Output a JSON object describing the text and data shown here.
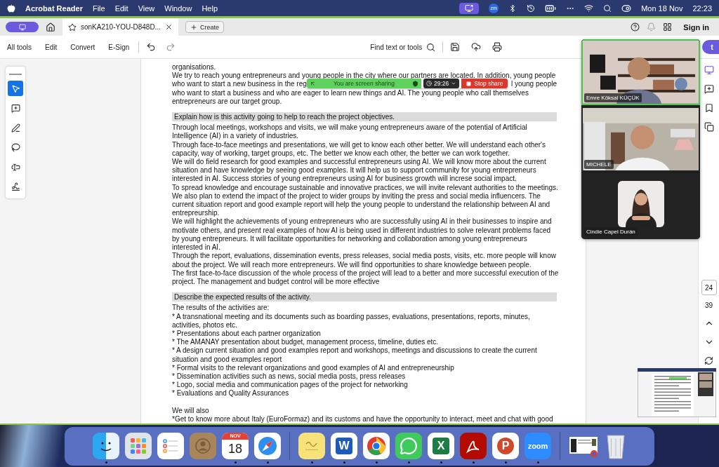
{
  "menu_bar": {
    "app_name": "Acrobat Reader",
    "menus": [
      "File",
      "Edit",
      "View",
      "Window",
      "Help"
    ],
    "zoom_badge": "zm",
    "date": "Mon 18 Nov",
    "time": "22:23"
  },
  "tab_bar": {
    "tabs": [
      {
        "label": "sonKA210-YOU-D848D...",
        "selected": true
      }
    ],
    "create_button": "Create",
    "sign_in": "Sign in"
  },
  "toolbar": {
    "items": [
      "All tools",
      "Edit",
      "Convert",
      "E-Sign"
    ],
    "search": "Find text or tools",
    "action_button": "t"
  },
  "tools": [
    {
      "kind": "select",
      "selected": true
    },
    {
      "kind": "comment",
      "selected": false
    },
    {
      "kind": "draw",
      "selected": false
    },
    {
      "kind": "lasso",
      "selected": false
    },
    {
      "kind": "text",
      "selected": false
    },
    {
      "kind": "sign",
      "selected": false
    }
  ],
  "document": {
    "blocks": [
      {
        "kind": "text",
        "text": "organisations."
      },
      {
        "kind": "text",
        "text": "We try to reach young entrepreneurs and young people in the city where our partners are located. In addition, young people"
      },
      {
        "kind": "split",
        "left": "who want to start a new business in the reg",
        "right": "l young people"
      },
      {
        "kind": "text",
        "text": "who want to start a business and who are eager to learn new things and AI. The young people who call themselves entrepreneurs are our target group."
      },
      {
        "kind": "heading",
        "text": "Explain how is this activity going to help to reach the project objectives."
      },
      {
        "kind": "text",
        "text": "Through local meetings, workshops and visits, we will make young entrepreneurs aware of the potential of Artificial Intelligence (AI) in a variety of industries."
      },
      {
        "kind": "text",
        "text": "Through face-to-face meetings and presentations, we will get to know each other better. We will understand each other's capacity, way of working, target groups, etc. The better we know each other, the better we can work together."
      },
      {
        "kind": "text",
        "text": "We will do field research for good examples and successful entrepreneurs using AI. We will know more about the current situation and have knowledge by seeing good examples. It will help us to support community for young entrepreneurs interested in AI. Success stories of young entrepreneurs using AI for business growth will increse social impact."
      },
      {
        "kind": "text",
        "text": "To spread knowledge and encourage sustainable and innovative practices, we will invite relevant authorities to the meetings. We also plan to extend the impact of the project to wider groups by inviting the press and social media influencers. The current situation report and good example report will help the young people to understand the relationship between AI and entrepreurship."
      },
      {
        "kind": "text",
        "text": "We will highlight the achievements of young entrepreneurs who are successfully using AI in their businesses to inspire and motivate others, and present real examples of how AI is being used in different industries to solve relevant problems faced by young entrepreneurs. It will facilitate opportunities for networking and collaboration among young entrepreneurs interested in AI."
      },
      {
        "kind": "text",
        "text": "Through the report, evaluations, dissemination events, press releases, social media posts, visits, etc. more people will know about the project. We will reach more entrepreneurs. We will find opportunities to share knowledge between people."
      },
      {
        "kind": "text",
        "text": "The first face-to-face discussion of the whole process of the project will lead to a better and more successful execution of the project. The management and budget control will be more effective"
      },
      {
        "kind": "heading",
        "text": "Describe the expected results of the activity."
      },
      {
        "kind": "text",
        "text": "The results of the activities are:"
      },
      {
        "kind": "text",
        "text": "* A transnational meeting and its documents such as boarding passes, evaluations, presentations, reports, minutes, activities, photos etc."
      },
      {
        "kind": "text",
        "text": "* Presentations about each partner organization"
      },
      {
        "kind": "text",
        "text": "* The AMANAY presentation about budget, management process, timeline, duties etc."
      },
      {
        "kind": "text",
        "text": "* A design current situation and good examples report and workshops, meetings and discussions to create the current situation and good examples report"
      },
      {
        "kind": "text",
        "text": "* Formal visits to the relevant organizations and good examples of AI and entrepreneurship"
      },
      {
        "kind": "text",
        "text": "* Dissemination activities such as news, social media posts, press releases"
      },
      {
        "kind": "text",
        "text": "* Logo, social media and communication pages of the project for networking"
      },
      {
        "kind": "text",
        "text": "* Evaluations and Quality Assurances"
      },
      {
        "kind": "gap_text",
        "text": "We will also"
      },
      {
        "kind": "text",
        "text": "*Get to know more about Italy (EuroFormaz) and its customs and have the opportunity to interact, meet and chat with good"
      }
    ]
  },
  "page_nav": {
    "current": "24",
    "total": "39"
  },
  "screen_share": {
    "status": "You are screen sharing",
    "timer": "29:26",
    "stop": "Stop share"
  },
  "participants": [
    {
      "name": "Emre Köksal KÜÇÜK",
      "kind": "video",
      "speaking": true
    },
    {
      "name": "MICHELE",
      "kind": "video",
      "speaking": false
    },
    {
      "name": "Cindie Capel Durán",
      "kind": "avatar",
      "speaking": false
    }
  ],
  "dock": [
    {
      "kind": "finder",
      "running": true
    },
    {
      "kind": "launchpad",
      "running": false
    },
    {
      "kind": "reminders",
      "running": false
    },
    {
      "kind": "contacts",
      "running": false
    },
    {
      "kind": "calendar",
      "label": "NOV",
      "sublabel": "18",
      "running": true
    },
    {
      "kind": "safari",
      "running": true
    },
    {
      "kind": "separator"
    },
    {
      "kind": "notes",
      "running": true
    },
    {
      "kind": "word",
      "label": "W",
      "running": true
    },
    {
      "kind": "chrome",
      "running": true
    },
    {
      "kind": "whatsapp",
      "running": true
    },
    {
      "kind": "excel",
      "label": "X",
      "running": true
    },
    {
      "kind": "acrobat",
      "running": true
    },
    {
      "kind": "powerpoint",
      "label": "P",
      "running": true
    },
    {
      "kind": "zoom",
      "label": "zoom",
      "running": true
    },
    {
      "kind": "separator"
    },
    {
      "kind": "window",
      "running": false
    },
    {
      "kind": "trash",
      "running": false
    }
  ]
}
